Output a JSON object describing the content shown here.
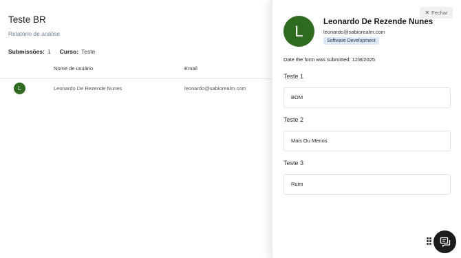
{
  "report": {
    "title": "Teste BR",
    "subtitle": "Relatório de análise",
    "submissions_label": "Submissões:",
    "submissions_value": "1",
    "course_label": "Curso:",
    "course_value": "Teste",
    "table": {
      "columns": [
        "Nome de usuário",
        "Email"
      ],
      "rows": [
        {
          "avatar_letter": "L",
          "name": "Leonardo De Rezende Nunes",
          "email": "leonardo@sabiorealm.com"
        }
      ]
    }
  },
  "drawer": {
    "close_label": "Fechar",
    "avatar_letter": "L",
    "user_name": "Leonardo De Rezende Nunes",
    "user_email": "leonardo@sabiorealm.com",
    "department": "Software Development",
    "submitted_text": "Date the form was submitted: 12/8/2025",
    "questions": [
      {
        "label": "Teste 1",
        "answer": "BOM"
      },
      {
        "label": "Teste 2",
        "answer": "Mais Ou Menos"
      },
      {
        "label": "Teste 3",
        "answer": "Ruim"
      }
    ]
  },
  "icons": {
    "close": "close-icon",
    "drag": "drag-handle-icon",
    "chat": "chat-icon"
  },
  "colors": {
    "avatar": "#2e6b1f",
    "badge_bg": "#dde9f7",
    "chat_button": "#1d1d1d",
    "subtitle": "#6f7f98"
  }
}
